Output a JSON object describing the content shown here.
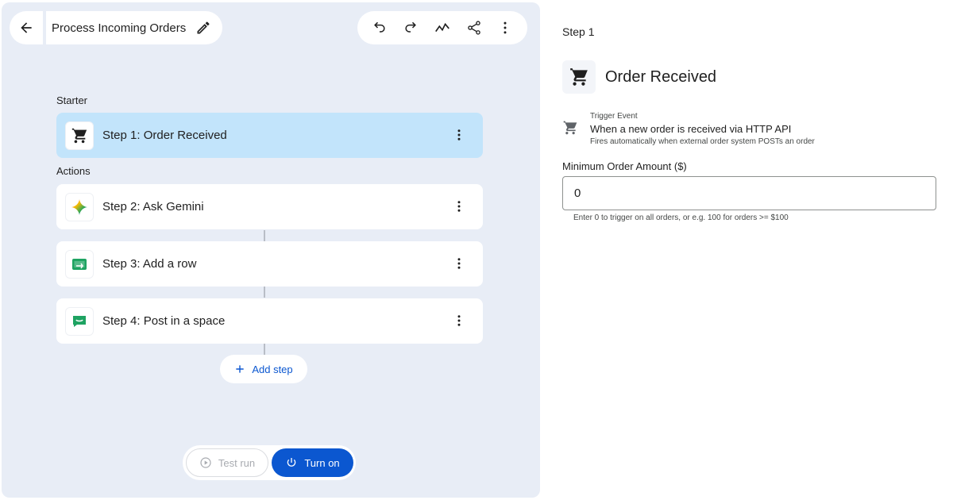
{
  "header": {
    "back_icon": "arrow-left-icon",
    "title": "Process Incoming Orders",
    "edit_icon": "pencil-icon",
    "toolbar": {
      "undo_icon": "undo-icon",
      "redo_icon": "redo-icon",
      "activity_icon": "activity-icon",
      "share_icon": "share-icon",
      "more_icon": "more-vert-icon"
    }
  },
  "workflow": {
    "starter_label": "Starter",
    "actions_label": "Actions",
    "steps": [
      {
        "num": "Step 1:",
        "name": "Order Received",
        "icon": "cart-icon",
        "selected": true
      },
      {
        "num": "Step 2:",
        "name": "Ask Gemini",
        "icon": "gemini-icon"
      },
      {
        "num": "Step 3:",
        "name": "Add a row",
        "icon": "sheets-icon"
      },
      {
        "num": "Step 4:",
        "name": "Post in a space",
        "icon": "chat-icon"
      }
    ],
    "add_step_label": "Add step"
  },
  "run_bar": {
    "test_run_label": "Test run",
    "turn_on_label": "Turn on"
  },
  "panel": {
    "step_label": "Step 1",
    "title": "Order Received",
    "trigger_label": "Trigger Event",
    "trigger_main": "When a new order is received via HTTP API",
    "trigger_sub": "Fires automatically when external order system POSTs an order",
    "field_label": "Minimum Order Amount ($)",
    "field_value": "0",
    "field_help": "Enter 0 to trigger on all orders, or e.g. 100 for orders >= $100"
  },
  "colors": {
    "canvas_bg": "#e8edf6",
    "selected_step": "#c2e4fb",
    "primary": "#0b57d0"
  }
}
